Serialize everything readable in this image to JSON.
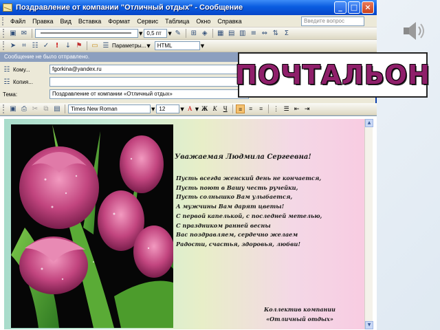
{
  "window": {
    "title": "Поздравление от компании \"Отличный отдых\" - Сообщение",
    "controls": [
      "_",
      "□",
      "×"
    ]
  },
  "menubar": {
    "items": [
      "Файл",
      "Правка",
      "Вид",
      "Вставка",
      "Формат",
      "Сервис",
      "Таблица",
      "Окно",
      "Справка"
    ],
    "help_placeholder": "Введите вопрос"
  },
  "toolbar1": {
    "line_width": "0,5 пт"
  },
  "toolbar2": {
    "options_label": "Параметры...",
    "format_value": "HTML"
  },
  "infobar": {
    "text": "Сообщение не было отправлено."
  },
  "header": {
    "to_label": "Кому...",
    "to_value": "fgorkina@yandex.ru",
    "cc_label": "Копия...",
    "cc_value": "",
    "subject_label": "Тема:",
    "subject_value": "Поздравление от компании «Отличный отдых»"
  },
  "format_bar": {
    "font": "Times New Roman",
    "size": "12"
  },
  "letter": {
    "greeting": "Уважаемая Людмила Сергеевна!",
    "lines": [
      "Пусть всегда женский день не кончается,",
      "Пусть поют в Вашу честь ручейки,",
      "Пусть солнышко Вам улыбается,",
      "А мужчины Вам дарят цветы!",
      "С первой капелькой, с последней метелью,",
      "С праздником ранней весны",
      "Вас поздравляем, сердечно желаем",
      "Радости, счастья, здоровья, любви!"
    ],
    "signature": [
      "Коллектив компании",
      "«Отличный отдых»"
    ]
  },
  "overlay": {
    "brand": "ПОЧТАЛЬОН"
  },
  "colors": {
    "titlebar": "#0a5ce0",
    "brand_text": "#8f1f6a",
    "tulip": "#c2457f"
  }
}
